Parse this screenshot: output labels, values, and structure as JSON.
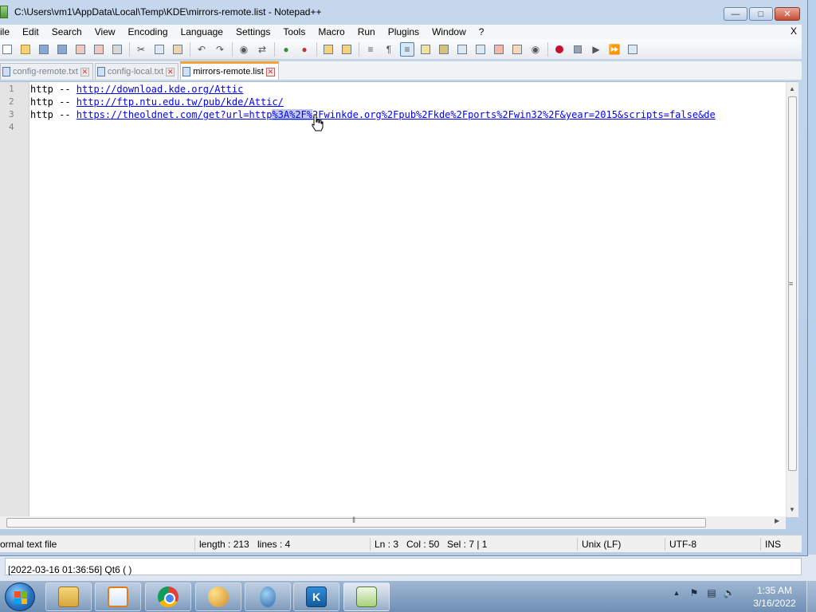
{
  "window": {
    "title": "C:\\Users\\vm1\\AppData\\Local\\Temp\\KDE\\mirrors-remote.list - Notepad++",
    "minimize_glyph": "—",
    "maximize_glyph": "□",
    "close_glyph": "✕"
  },
  "menu": {
    "items": [
      "ile",
      "Edit",
      "Search",
      "View",
      "Encoding",
      "Language",
      "Settings",
      "Tools",
      "Macro",
      "Run",
      "Plugins",
      "Window",
      "?"
    ],
    "close_label": "X"
  },
  "toolbar": {
    "buttons": [
      "new-file-icon",
      "open-file-icon",
      "save-icon",
      "save-all-icon",
      "close-icon",
      "close-all-icon",
      "print-icon",
      "cut-icon",
      "copy-icon",
      "paste-icon",
      "undo-icon",
      "redo-icon",
      "find-icon",
      "replace-icon",
      "zoom-in-icon",
      "zoom-out-icon",
      "sync-vertical-icon",
      "sync-horizontal-icon",
      "word-wrap-icon",
      "show-all-chars-icon",
      "indent-guide-icon",
      "doc-map-icon",
      "function-list-icon",
      "folder-workspace-icon",
      "doc-list-icon",
      "monitoring-icon",
      "user-lang-icon",
      "record-macro-icon",
      "stop-recording-icon",
      "play-macro-icon",
      "run-macro-multiple-icon",
      "save-macro-icon"
    ],
    "active_button": "indent-guide-icon"
  },
  "tabs": [
    {
      "label": "config-remote.txt",
      "active": false
    },
    {
      "label": "config-local.txt",
      "active": false
    },
    {
      "label": "mirrors-remote.list",
      "active": true
    }
  ],
  "editor": {
    "lines": [
      {
        "number": "1",
        "prefix": "http -- ",
        "link": "http://download.kde.org/Attic",
        "link_pre": "",
        "selected": "",
        "link_post": ""
      },
      {
        "number": "2",
        "prefix": "http -- ",
        "link": "http://ftp.ntu.edu.tw/pub/kde/Attic/",
        "link_pre": "",
        "selected": "",
        "link_post": ""
      },
      {
        "number": "3",
        "prefix": "http -- ",
        "link": "",
        "link_pre": "https://theoldnet.com/get?url=http",
        "selected": "%3A%2F%",
        "link_post": "2Fwinkde.org%2Fpub%2Fkde%2Fports%2Fwin32%2F&year=2015&scripts=false&de"
      },
      {
        "number": "4",
        "prefix": "",
        "link": "",
        "link_pre": "",
        "selected": "",
        "link_post": ""
      }
    ]
  },
  "status": {
    "file_type": "ormal text file",
    "length": "length : 213",
    "lines": "lines : 4",
    "ln": "Ln : 3",
    "col": "Col : 50",
    "sel": "Sel : 7 | 1",
    "eol": "Unix (LF)",
    "encoding": "UTF-8",
    "mode": "INS"
  },
  "background_window": {
    "log_text": "[2022-03-16 01:36:56] Qt6 (  )"
  },
  "taskbar": {
    "apps": [
      "windows-explorer",
      "media-player",
      "chrome",
      "paint",
      "drop-app",
      "kde",
      "notepad-plus-plus"
    ],
    "active_app": "notepad-plus-plus",
    "kde_glyph": "K",
    "tray_arrow": "▲",
    "time": "1:35 AM",
    "date": "3/16/2022"
  },
  "colors": {
    "link": "#0000ff",
    "selection": "#c0c8ea",
    "active_tab_accent": "#f4a437",
    "gutter": "#e4e4e4"
  }
}
